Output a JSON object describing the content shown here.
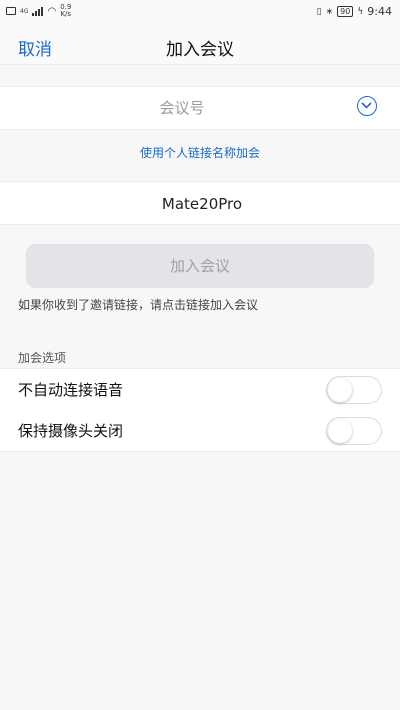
{
  "status_bar": {
    "network": "4G",
    "speed_value": "0.9",
    "speed_unit": "K/s",
    "battery": "90",
    "time": "9:44"
  },
  "nav": {
    "cancel_label": "取消",
    "title": "加入会议"
  },
  "meeting_id": {
    "placeholder": "会议号",
    "value": ""
  },
  "personal_link_label": "使用个人链接名称加会",
  "display_name": {
    "value": "Mate20Pro"
  },
  "join_button_label": "加入会议",
  "invite_hint": "如果你收到了邀请链接，请点击链接加入会议",
  "options_section_label": "加会选项",
  "options": [
    {
      "label": "不自动连接语音",
      "enabled": false
    },
    {
      "label": "保持摄像头关闭",
      "enabled": false
    }
  ],
  "colors": {
    "accent": "#1a6bc4",
    "background": "#f7f7f7",
    "button_disabled_bg": "#e4e4e8",
    "button_disabled_text": "#a0a0a6"
  }
}
